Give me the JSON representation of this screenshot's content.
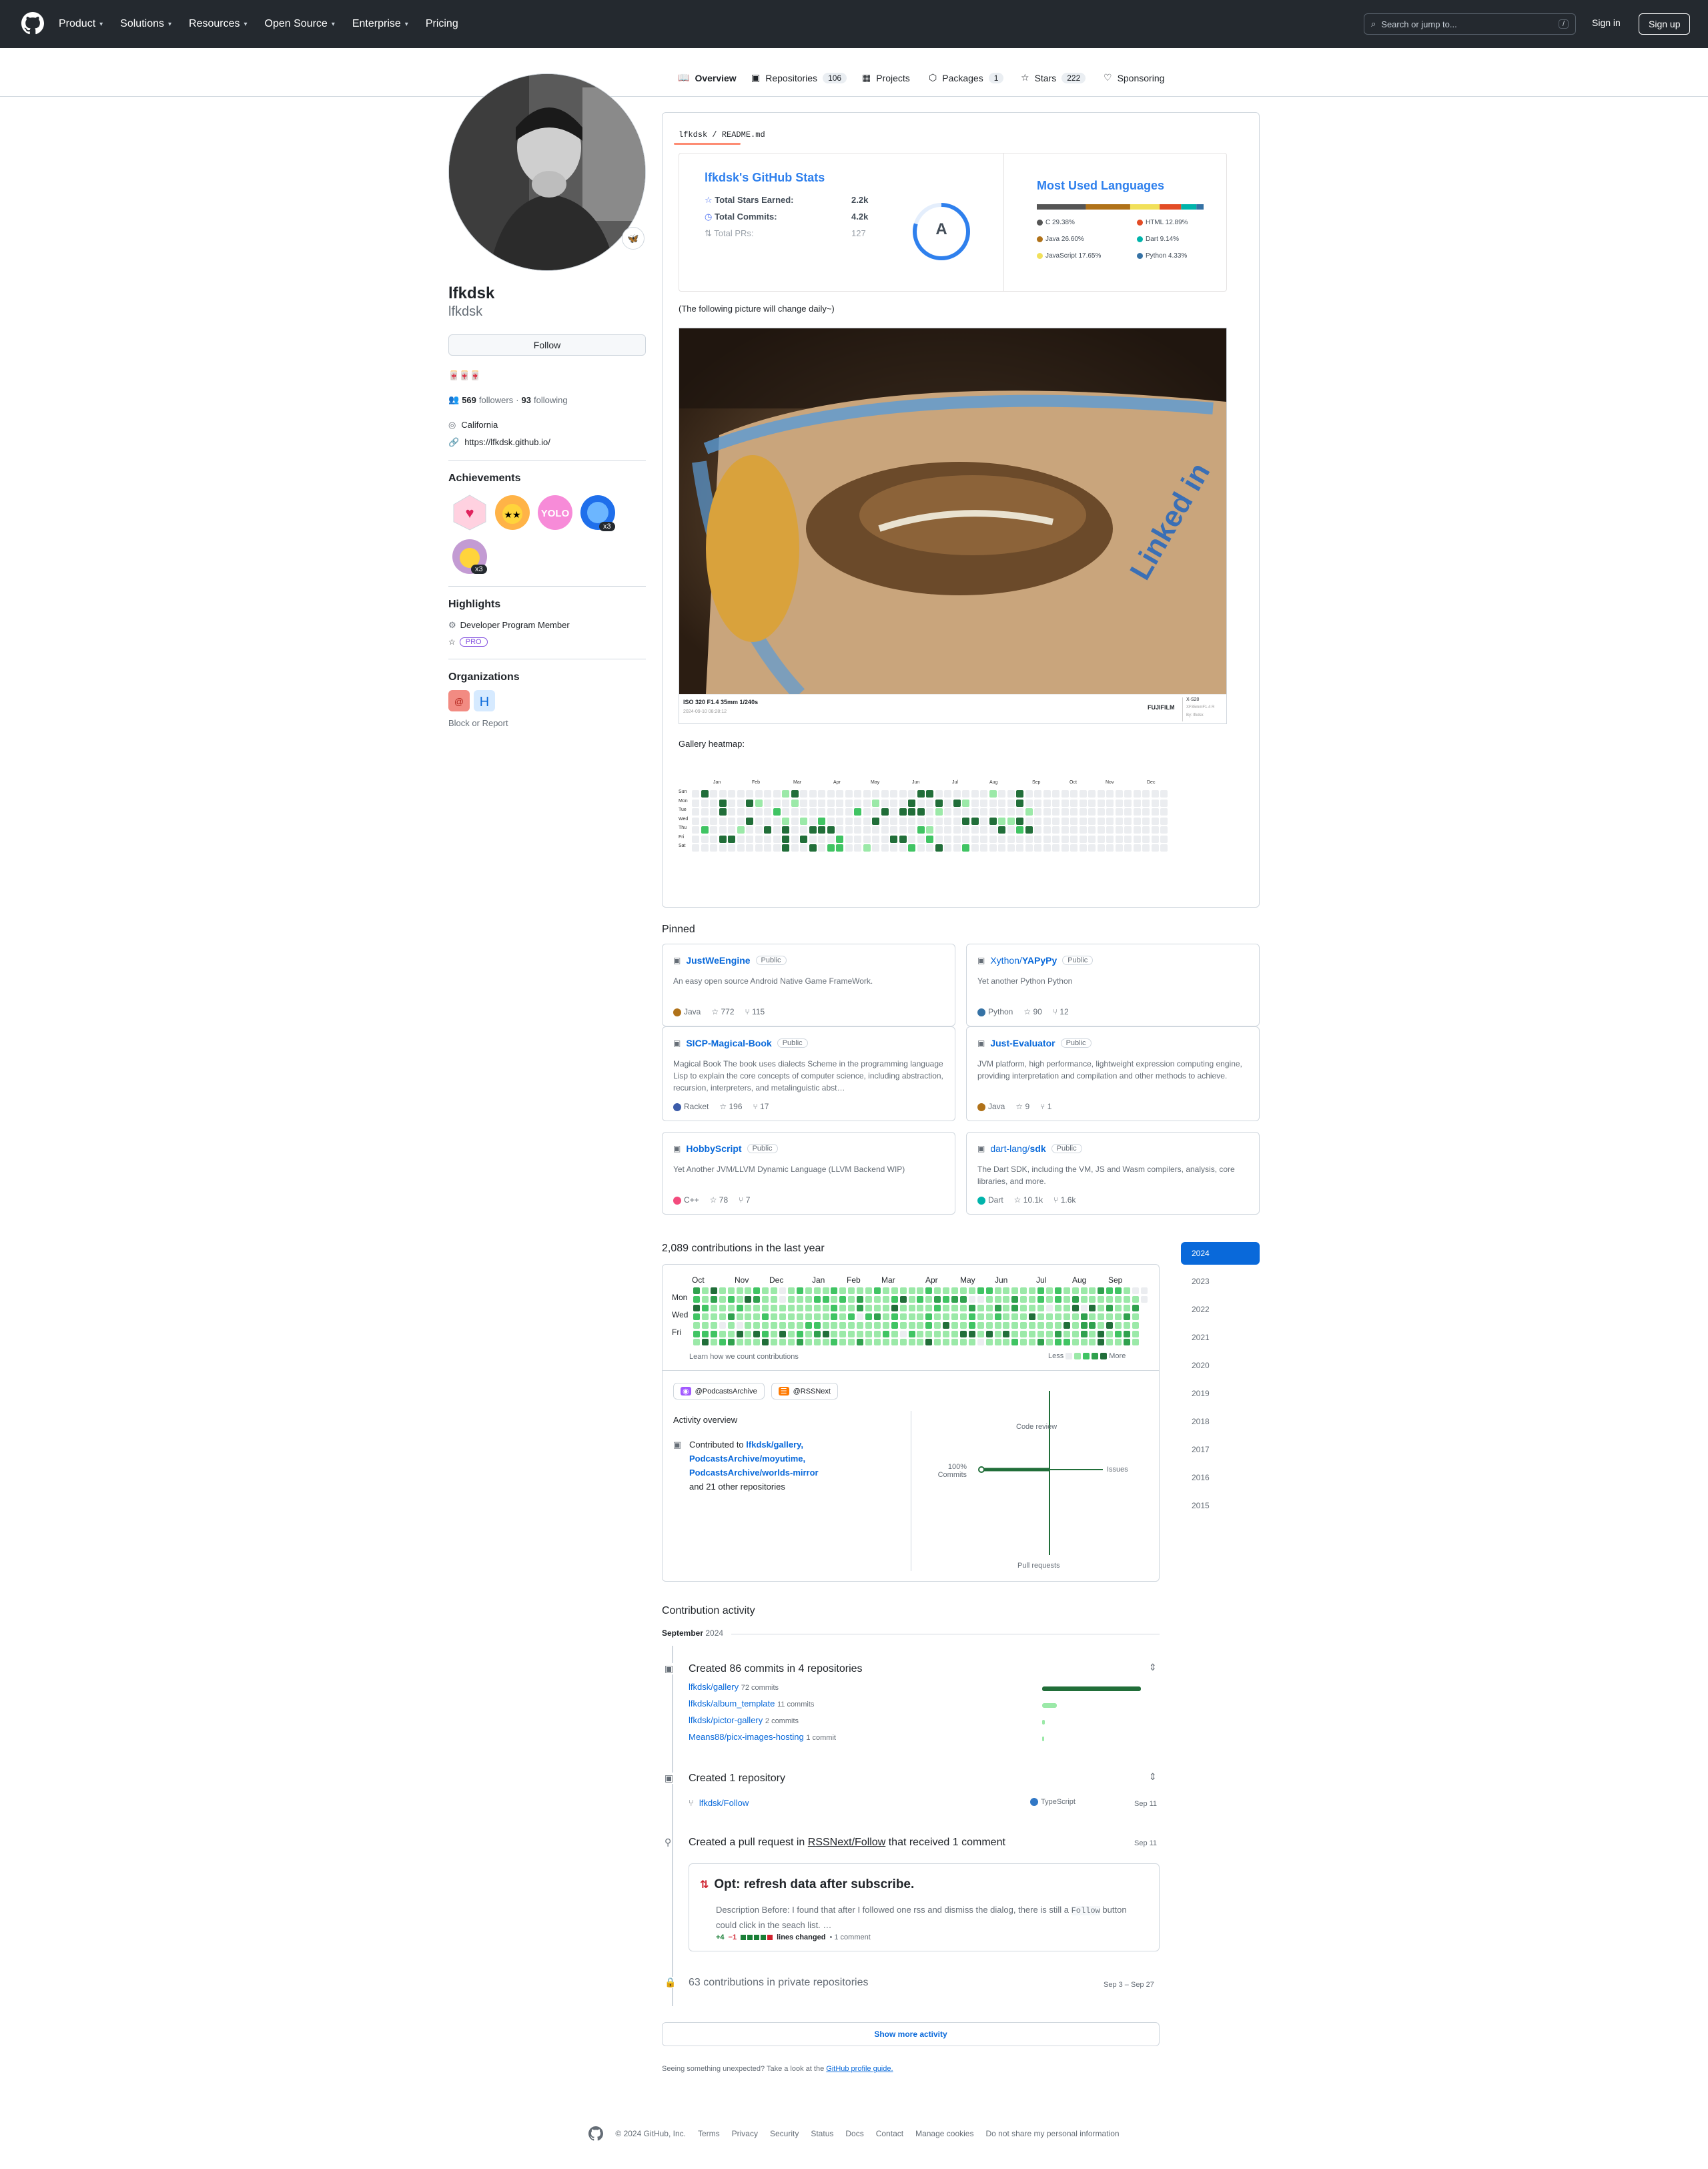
{
  "header": {
    "nav": [
      "Product",
      "Solutions",
      "Resources",
      "Open Source",
      "Enterprise",
      "Pricing"
    ],
    "search_placeholder": "Search or jump to...",
    "search_key": "/",
    "signin": "Sign in",
    "signup": "Sign up"
  },
  "tabs": [
    {
      "label": "Overview",
      "count": ""
    },
    {
      "label": "Repositories",
      "count": "106"
    },
    {
      "label": "Projects",
      "count": ""
    },
    {
      "label": "Packages",
      "count": "1"
    },
    {
      "label": "Stars",
      "count": "222"
    },
    {
      "label": "Sponsoring",
      "count": ""
    }
  ],
  "profile": {
    "name": "lfkdsk",
    "username": "lfkdsk",
    "follow": "Follow",
    "bio": "🀄🀄🀄",
    "followers": "569",
    "followers_label": "followers",
    "following": "93",
    "following_label": "following",
    "location": "California",
    "website": "https://lfkdsk.github.io/",
    "status_emoji": "🦋",
    "achievements_title": "Achievements",
    "achievement_badges": [
      "x3",
      "x3"
    ],
    "highlights_title": "Highlights",
    "highlight_item": "Developer Program Member",
    "pro_badge": "PRO",
    "orgs_title": "Organizations",
    "block": "Block or Report"
  },
  "readme": {
    "path_user": "lfkdsk",
    "path_file": "README.md",
    "stats_title": "lfkdsk's GitHub Stats",
    "stats": [
      {
        "label": "Total Stars Earned:",
        "value": "2.2k"
      },
      {
        "label": "Total Commits:",
        "value": "4.2k"
      },
      {
        "label": "Total PRs:",
        "value": "127"
      }
    ],
    "grade": "A",
    "lang_title": "Most Used Languages",
    "langs": [
      {
        "name": "C 29.38%",
        "color": "#555555",
        "pct": 29.38
      },
      {
        "name": "HTML 12.89%",
        "color": "#e34c26",
        "pct": 12.89
      },
      {
        "name": "Java 26.60%",
        "color": "#b07219",
        "pct": 26.6
      },
      {
        "name": "Dart 9.14%",
        "color": "#00b4ab",
        "pct": 9.14
      },
      {
        "name": "JavaScript 17.65%",
        "color": "#f1e05a",
        "pct": 17.65
      },
      {
        "name": "Python 4.33%",
        "color": "#3572A5",
        "pct": 4.33
      }
    ],
    "picture_note": "(The following picture will change daily~)",
    "photo_meta": "ISO 320 F1.4 35mm 1/240s",
    "photo_date": "2024-09-10 08:28:12",
    "photo_brand": "FUJIFILM",
    "photo_camera": "X-S20",
    "photo_lens": "XF35mmF1.4 R",
    "photo_author": "By: lfkdsk",
    "gallery_title": "Gallery heatmap:",
    "gallery_months": [
      "Jan",
      "Feb",
      "Mar",
      "Apr",
      "May",
      "Jun",
      "Jul",
      "Aug",
      "Sep",
      "Oct",
      "Nov",
      "Dec"
    ],
    "gallery_days": [
      "Sun",
      "Mon",
      "Tue",
      "Wed",
      "Thu",
      "Fri",
      "Sat"
    ]
  },
  "pinned": {
    "title": "Pinned",
    "items": [
      {
        "owner": "",
        "name": "JustWeEngine",
        "vis": "Public",
        "desc": "An easy open source Android Native Game FrameWork.",
        "lang": "Java",
        "color": "#b07219",
        "stars": "772",
        "forks": "115"
      },
      {
        "owner": "Xython/",
        "name": "YAPyPy",
        "vis": "Public",
        "desc": "Yet another Python Python",
        "lang": "Python",
        "color": "#3572A5",
        "stars": "90",
        "forks": "12"
      },
      {
        "owner": "",
        "name": "SICP-Magical-Book",
        "vis": "Public",
        "desc": "Magical Book The book uses dialects Scheme in the programming language Lisp to explain the core concepts of computer science, including abstraction, recursion, interpreters, and metalinguistic abst…",
        "lang": "Racket",
        "color": "#3c5caa",
        "stars": "196",
        "forks": "17"
      },
      {
        "owner": "",
        "name": "Just-Evaluator",
        "vis": "Public",
        "desc": "JVM platform, high performance, lightweight expression computing engine, providing interpretation and compilation and other methods to achieve.",
        "lang": "Java",
        "color": "#b07219",
        "stars": "9",
        "forks": "1"
      },
      {
        "owner": "",
        "name": "HobbyScript",
        "vis": "Public",
        "desc": "Yet Another JVM/LLVM Dynamic Language (LLVM Backend WIP)",
        "lang": "C++",
        "color": "#f34b7d",
        "stars": "78",
        "forks": "7"
      },
      {
        "owner": "dart-lang/",
        "name": "sdk",
        "vis": "Public",
        "desc": "The Dart SDK, including the VM, JS and Wasm compilers, analysis, core libraries, and more.",
        "lang": "Dart",
        "color": "#00b4ab",
        "stars": "10.1k",
        "forks": "1.6k"
      }
    ]
  },
  "contrib": {
    "title": "2,089 contributions in the last year",
    "months": [
      "Oct",
      "Nov",
      "Dec",
      "Jan",
      "Feb",
      "Mar",
      "Apr",
      "May",
      "Jun",
      "Jul",
      "Aug",
      "Sep"
    ],
    "days": [
      "Mon",
      "Wed",
      "Fri"
    ],
    "learn": "Learn how we count contributions",
    "less": "Less",
    "more": "More",
    "years": [
      "2024",
      "2023",
      "2022",
      "2021",
      "2020",
      "2019",
      "2018",
      "2017",
      "2016",
      "2015"
    ],
    "orgs": [
      "@PodcastsArchive",
      "@RSSNext"
    ],
    "overview_title": "Activity overview",
    "contributed_to": "Contributed to",
    "repo1": "lfkdsk/gallery,",
    "repo2": "PodcastsArchive/moyutime,",
    "repo3": "PodcastsArchive/worlds-mirror",
    "and_more": "and 21 other repositories",
    "axis_top": "Code review",
    "axis_right": "Issues",
    "axis_bottom": "Pull requests",
    "axis_left_pct": "100%",
    "axis_left": "Commits"
  },
  "activity": {
    "title": "Contribution activity",
    "month": "September",
    "year": "2024",
    "commits_title": "Created 86 commits in 4 repositories",
    "commit_repos": [
      {
        "name": "lfkdsk/gallery",
        "count": "72 commits",
        "frac": 1.0
      },
      {
        "name": "lfkdsk/album_template",
        "count": "11 commits",
        "frac": 0.15
      },
      {
        "name": "lfkdsk/pictor-gallery",
        "count": "2 commits",
        "frac": 0.03
      },
      {
        "name": "Means88/picx-images-hosting",
        "count": "1 commit",
        "frac": 0.015
      }
    ],
    "repo_title": "Created 1 repository",
    "new_repo": "lfkdsk/Follow",
    "new_repo_lang": "TypeScript",
    "new_repo_date": "Sep 11",
    "pr_prefix": "Created a pull request in",
    "pr_repo": "RSSNext/Follow",
    "pr_suffix": "that received 1 comment",
    "pr_date": "Sep 11",
    "pr_title": "Opt: refresh data after subscribe.",
    "pr_desc": "Description Before: I found that after I followed one rss and dismiss the dialog, there is still a",
    "pr_code": "Follow",
    "pr_desc2": "button could click in the seach list. …",
    "pr_add": "+4",
    "pr_del": "−1",
    "pr_lines": "lines changed",
    "pr_comments": "• 1 comment",
    "private": "63 contributions in private repositories",
    "private_range": "Sep 3 – Sep 27",
    "show_more": "Show more activity",
    "unexpected": "Seeing something unexpected? Take a look at the",
    "guide": "GitHub profile guide."
  },
  "footer": {
    "copy": "© 2024 GitHub, Inc.",
    "links": [
      "Terms",
      "Privacy",
      "Security",
      "Status",
      "Docs",
      "Contact",
      "Manage cookies",
      "Do not share my personal information"
    ]
  }
}
